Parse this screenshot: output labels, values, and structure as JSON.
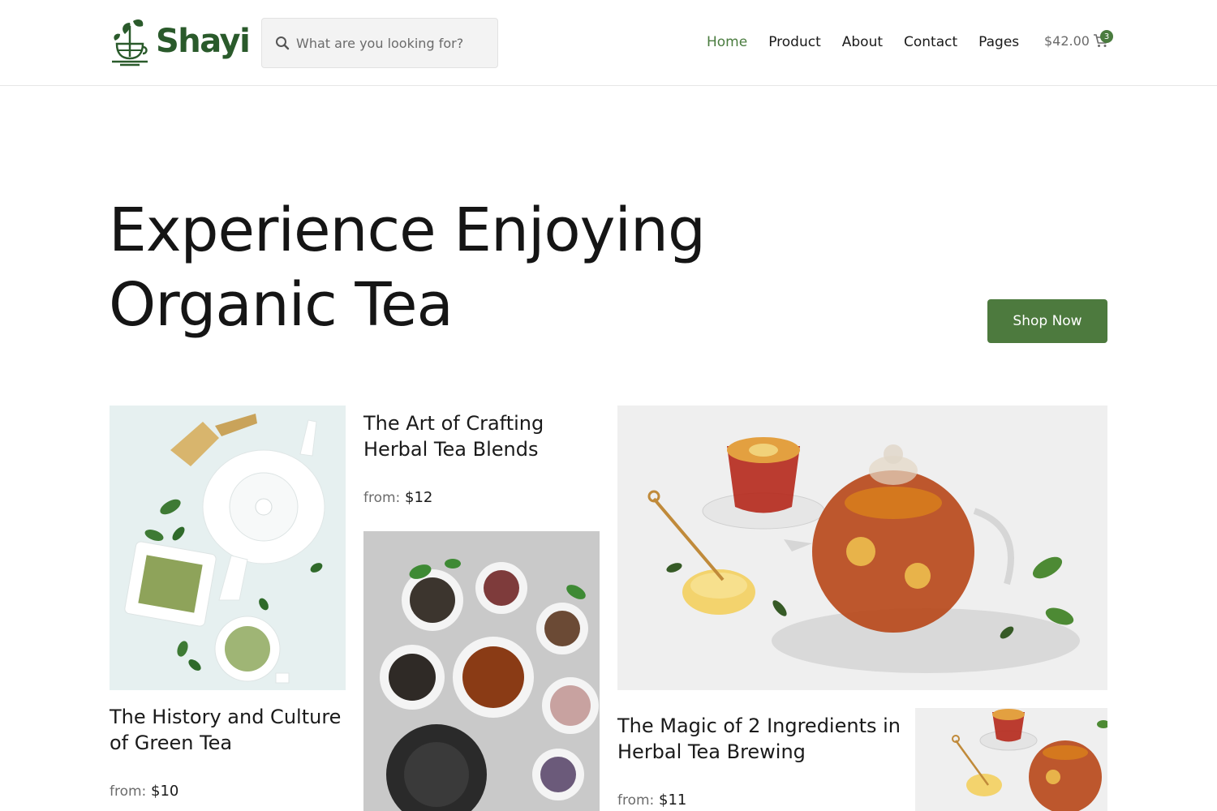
{
  "header": {
    "brand": "Shayi",
    "search_placeholder": "What are you looking for?",
    "nav": [
      {
        "label": "Home",
        "active": true
      },
      {
        "label": "Product",
        "active": false
      },
      {
        "label": "About",
        "active": false
      },
      {
        "label": "Contact",
        "active": false
      },
      {
        "label": "Pages",
        "active": false
      }
    ],
    "cart_total": "$42.00",
    "cart_count": "3"
  },
  "hero": {
    "title_line1": "Experience Enjoying",
    "title_line2": "Organic Tea",
    "cta_label": "Shop Now"
  },
  "products": [
    {
      "title_line1": "The History and Culture",
      "title_line2": "of Green Tea",
      "from_label": "from:",
      "price": "$10"
    },
    {
      "title_line1": "The Art of Crafting",
      "title_line2": "Herbal Tea Blends",
      "from_label": "from:",
      "price": "$12"
    },
    {
      "title_line1": "The Magic of 2 Ingredients in",
      "title_line2": "Herbal Tea Brewing",
      "from_label": "from:",
      "price": "$11"
    }
  ],
  "colors": {
    "brand_green": "#2a5a2b",
    "accent_green": "#4d7a3e"
  }
}
